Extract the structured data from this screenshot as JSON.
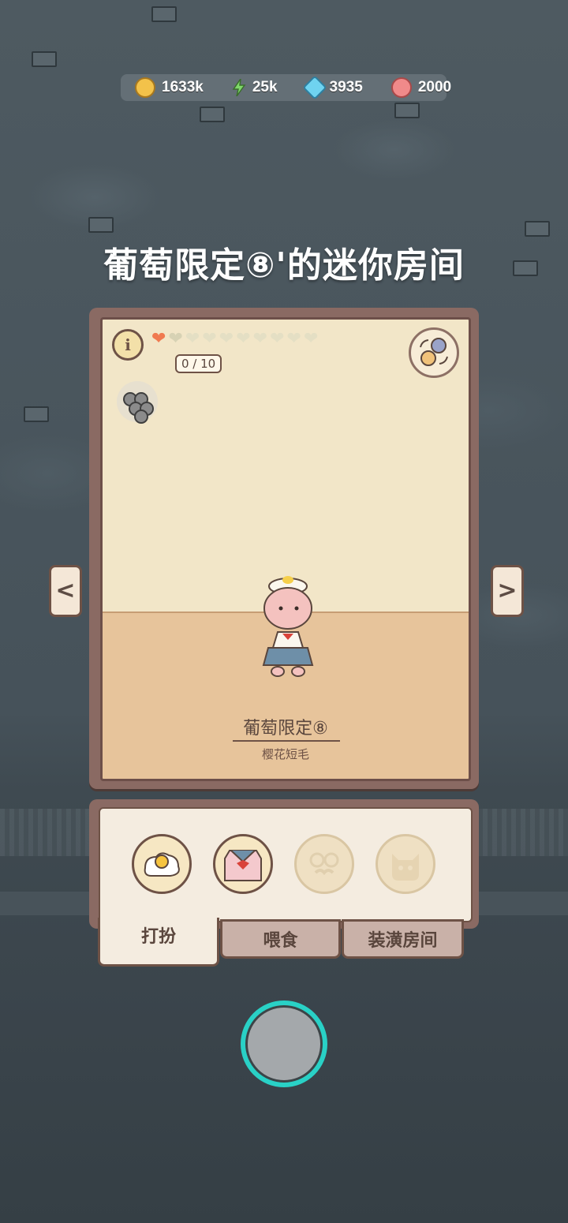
{
  "resources": {
    "coins": "1633k",
    "energy": "25k",
    "gems": "3935",
    "candy": "2000"
  },
  "room_title": "葡萄限定⑧'的迷你房间",
  "affection": {
    "count": "0 / 10",
    "filled": 1,
    "total": 10
  },
  "cat": {
    "name": "葡萄限定⑧",
    "breed": "樱花短毛"
  },
  "outfit_slots": [
    {
      "icon": "fried-egg-icon",
      "state": "owned"
    },
    {
      "icon": "sailor-uniform-icon",
      "state": "owned"
    },
    {
      "icon": "glasses-mustache-icon",
      "state": "empty"
    },
    {
      "icon": "cat-mask-icon",
      "state": "empty"
    }
  ],
  "tabs": [
    {
      "label": "打扮",
      "active": true
    },
    {
      "label": "喂食",
      "active": false
    },
    {
      "label": "装潢房间",
      "active": false
    }
  ],
  "nav": {
    "prev": "<",
    "next": ">"
  },
  "colors": {
    "accent": "#29d1c6",
    "wall": "#f2e6c8",
    "floor": "#e7c49b",
    "frame": "#8a6a63",
    "heart": "#f07a50"
  }
}
